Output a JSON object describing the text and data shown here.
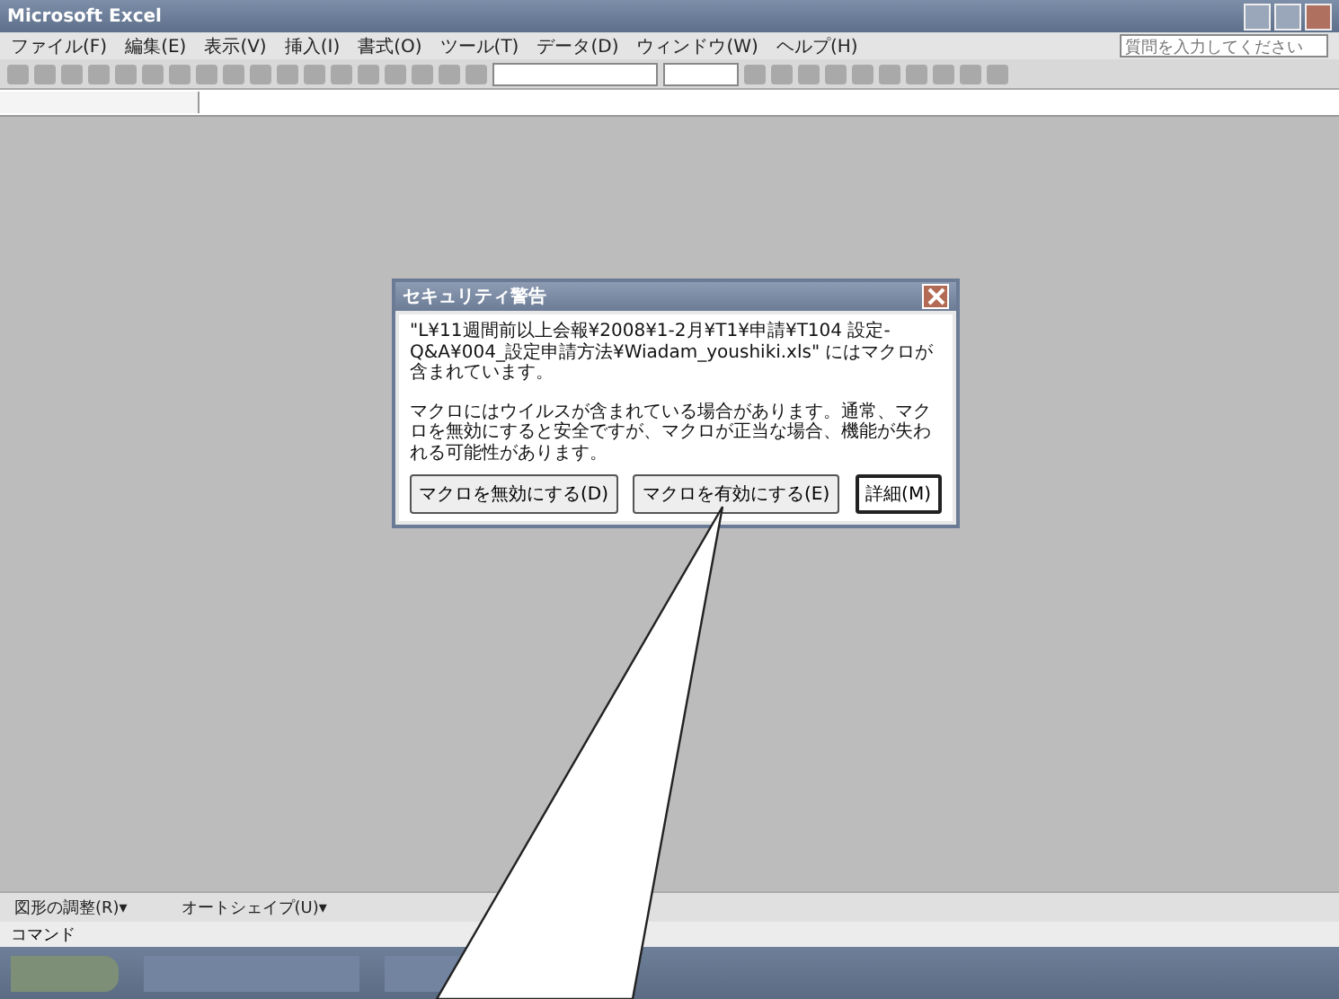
{
  "window": {
    "title": "Microsoft Excel"
  },
  "menu": [
    {
      "label": "ファイル(F)"
    },
    {
      "label": "編集(E)"
    },
    {
      "label": "表示(V)"
    },
    {
      "label": "挿入(I)"
    },
    {
      "label": "書式(O)"
    },
    {
      "label": "ツール(T)"
    },
    {
      "label": "データ(D)"
    },
    {
      "label": "ウィンドウ(W)"
    },
    {
      "label": "ヘルプ(H)"
    }
  ],
  "help_box": {
    "placeholder": "質問を入力してください"
  },
  "dialog": {
    "title": "セキュリティ警告",
    "message": "\"L¥11週間前以上会報¥2008¥1-2月¥T1¥申請¥T104 設定-Q&A¥004_設定申請方法¥Wiadam_youshiki.xls\" にはマクロが含まれています。",
    "warning": "マクロにはウイルスが含まれている場合があります。通常、マクロを無効にすると安全ですが、マクロが正当な場合、機能が失われる可能性があります。",
    "buttons": [
      {
        "label": "マクロを無効にする(D)",
        "selected": false
      },
      {
        "label": "マクロを有効にする(E)",
        "selected": false
      },
      {
        "label": "詳細(M)",
        "selected": true
      }
    ]
  },
  "draw_toolbar": [
    "図形の調整(R)▾",
    "オートシェイプ(U)▾"
  ],
  "status_bar": "コマンド"
}
